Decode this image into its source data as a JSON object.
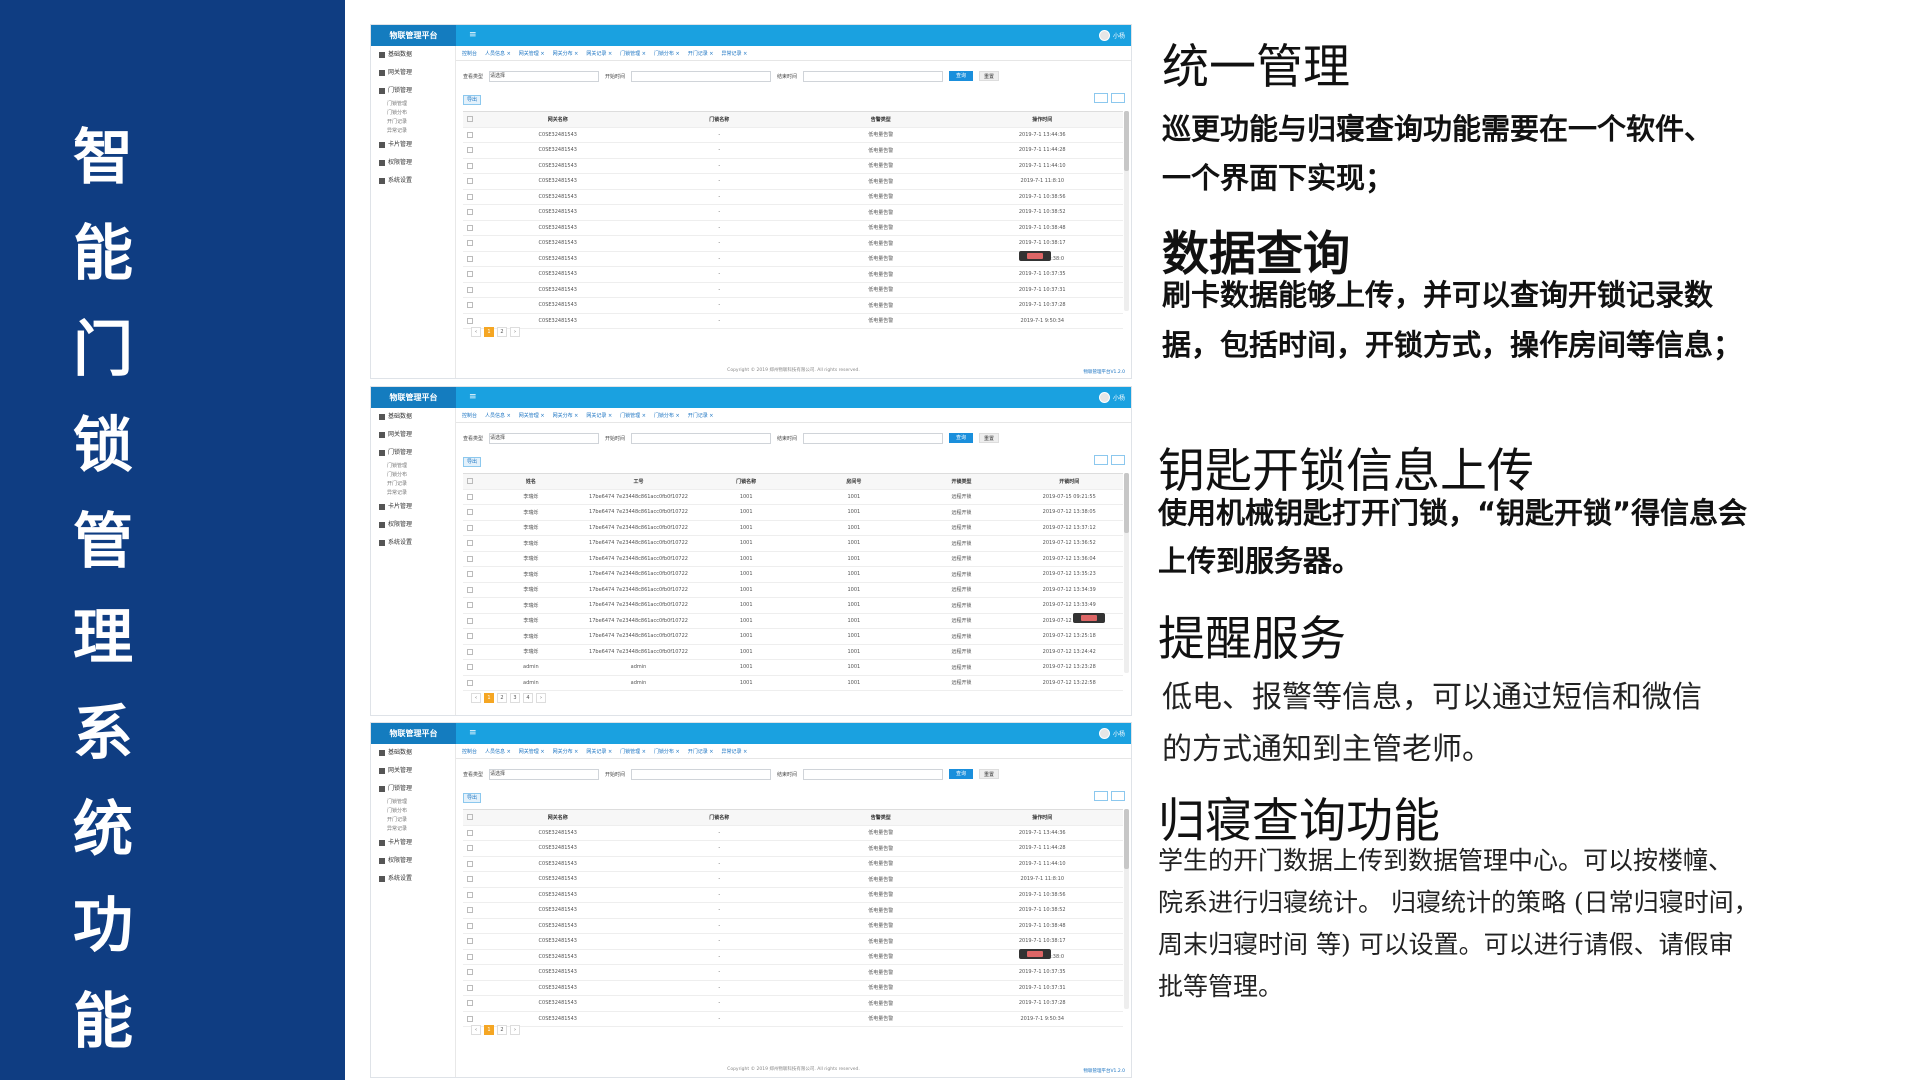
{
  "sidebar": {
    "title_chars": [
      "智",
      "能",
      "门",
      "锁",
      "管",
      "理",
      "系",
      "统",
      "功",
      "能"
    ]
  },
  "screens": {
    "brand": "物联管理平台",
    "menu_icon": "≡",
    "user_name": "小杨",
    "side_items": [
      "基础数据",
      "网关管理",
      "门锁管理",
      "卡片管理",
      "权限管理",
      "系统设置"
    ],
    "side_subs": [
      "门锁管理",
      "门锁分布",
      "开门记录",
      "异常记录"
    ],
    "tabs": [
      "控制台",
      "人员信息 ×",
      "网关管理 ×",
      "网关分布 ×",
      "网关记录 ×",
      "门锁管理 ×",
      "门锁分布 ×",
      "开门记录 ×",
      "异常记录 ×"
    ],
    "filter_label_type": "查看类型",
    "filter_select": "请选择",
    "filter_label_start": "开始时间",
    "filter_label_end": "结束时间",
    "btn_query": "查询",
    "btn_reset": "重置",
    "btn_export": "导出",
    "footer": "Copyright © 2019 郑州物联科技有限公司. All rights reserved.",
    "version": "物联管理平台V1.2.0",
    "grid1": {
      "headers": [
        "网关名称",
        "门锁名称",
        "告警类型",
        "操作时间"
      ],
      "rows": [
        [
          "C0SE32481543",
          "-",
          "低电量告警",
          "2019-7-1 13:44:36"
        ],
        [
          "C0SE32481543",
          "-",
          "低电量告警",
          "2019-7-1 11:44:28"
        ],
        [
          "C0SE32481543",
          "-",
          "低电量告警",
          "2019-7-1 11:44:10"
        ],
        [
          "C0SE32481543",
          "-",
          "低电量告警",
          "2019-7-1 11:8:10"
        ],
        [
          "C0SE32481543",
          "-",
          "低电量告警",
          "2019-7-1 10:38:56"
        ],
        [
          "C0SE32481543",
          "-",
          "低电量告警",
          "2019-7-1 10:38:52"
        ],
        [
          "C0SE32481543",
          "-",
          "低电量告警",
          "2019-7-1 10:38:48"
        ],
        [
          "C0SE32481543",
          "-",
          "低电量告警",
          "2019-7-1 10:38:17"
        ],
        [
          "C0SE32481543",
          "-",
          "低电量告警",
          "2019-7-1 10:38:0"
        ],
        [
          "C0SE32481543",
          "-",
          "低电量告警",
          "2019-7-1 10:37:35"
        ],
        [
          "C0SE32481543",
          "-",
          "低电量告警",
          "2019-7-1 10:37:31"
        ],
        [
          "C0SE32481543",
          "-",
          "低电量告警",
          "2019-7-1 10:37:28"
        ],
        [
          "C0SE32481543",
          "-",
          "低电量告警",
          "2019-7-1 9:50:34"
        ]
      ],
      "pages": [
        "‹",
        "1",
        "2",
        "›"
      ]
    },
    "grid2": {
      "headers": [
        "姓名",
        "工号",
        "门锁名称",
        "房间号",
        "开锁类型",
        "开锁时间"
      ],
      "rows": [
        [
          "李瑞烁",
          "17be6474 7e23448c861acc0fb0f10722",
          "1001",
          "1001",
          "远程开锁",
          "2019-07-15 09:21:55"
        ],
        [
          "李瑞烁",
          "17be6474 7e23448c861acc0fb0f10722",
          "1001",
          "1001",
          "远程开锁",
          "2019-07-12 13:38:05"
        ],
        [
          "李瑞烁",
          "17be6474 7e23448c861acc0fb0f10722",
          "1001",
          "1001",
          "远程开锁",
          "2019-07-12 13:37:12"
        ],
        [
          "李瑞烁",
          "17be6474 7e23448c861acc0fb0f10722",
          "1001",
          "1001",
          "远程开锁",
          "2019-07-12 13:36:52"
        ],
        [
          "李瑞烁",
          "17be6474 7e23448c861acc0fb0f10722",
          "1001",
          "1001",
          "远程开锁",
          "2019-07-12 13:36:04"
        ],
        [
          "李瑞烁",
          "17be6474 7e23448c861acc0fb0f10722",
          "1001",
          "1001",
          "远程开锁",
          "2019-07-12 13:35:23"
        ],
        [
          "李瑞烁",
          "17be6474 7e23448c861acc0fb0f10722",
          "1001",
          "1001",
          "远程开锁",
          "2019-07-12 13:34:39"
        ],
        [
          "李瑞烁",
          "17be6474 7e23448c861acc0fb0f10722",
          "1001",
          "1001",
          "远程开锁",
          "2019-07-12 13:33:49"
        ],
        [
          "李瑞烁",
          "17be6474 7e23448c861acc0fb0f10722",
          "1001",
          "1001",
          "远程开锁",
          "2019-07-12 13:33:00"
        ],
        [
          "李瑞烁",
          "17be6474 7e23448c861acc0fb0f10722",
          "1001",
          "1001",
          "远程开锁",
          "2019-07-12 13:25:18"
        ],
        [
          "李瑞烁",
          "17be6474 7e23448c861acc0fb0f10722",
          "1001",
          "1001",
          "远程开锁",
          "2019-07-12 13:24:42"
        ],
        [
          "admin",
          "admin",
          "1001",
          "1001",
          "远程开锁",
          "2019-07-12 13:23:28"
        ],
        [
          "admin",
          "admin",
          "1001",
          "1001",
          "远程开锁",
          "2019-07-12 13:22:58"
        ]
      ],
      "pages": [
        "‹",
        "1",
        "2",
        "3",
        "4",
        "›"
      ]
    }
  },
  "content": {
    "s1_title": "统一管理",
    "s1_l1": "巡更功能与归寝查询功能需要在一个软件、",
    "s1_l2": "一个界面下实现；",
    "s2_title": "数据查询",
    "s2_l1": " 刷卡数据能够上传，并可以查询开锁记录数",
    "s2_l2": "据，包括时间，开锁方式，操作房间等信息；",
    "s3_title": "钥匙开锁信息上传",
    "s3_l1": " 使用机械钥匙打开门锁，“钥匙开锁”得信息会",
    "s3_l2": "上传到服务器。",
    "s4_title": "提醒服务",
    "s4_l1": " 低电、报警等信息，可以通过短信和微信",
    "s4_l2": "的方式通知到主管老师。",
    "s5_title": "归寝查询功能",
    "s5_l1": " 学生的开门数据上传到数据管理中心。可以按楼幢、",
    "s5_l2": "院系进行归寝统计。 归寝统计的策略 (日常归寝时间，",
    "s5_l3": "周末归寝时间 等) 可以设置。可以进行请假、请假审",
    "s5_l4": "批等管理。"
  }
}
